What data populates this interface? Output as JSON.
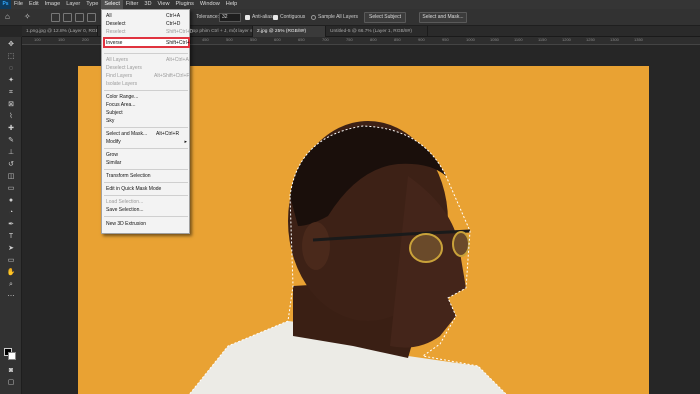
{
  "app": {
    "logo": "Ps"
  },
  "menubar": {
    "items": [
      "File",
      "Edit",
      "Image",
      "Layer",
      "Type",
      "Select",
      "Filter",
      "3D",
      "View",
      "Plugins",
      "Window",
      "Help"
    ]
  },
  "options": {
    "tolerance_label": "Tolerance:",
    "tolerance_value": "32",
    "anti_alias": "Anti-alias",
    "contiguous": "Contiguous",
    "sample_all_layers": "Sample All Layers",
    "select_subject": "Select Subject",
    "select_and_mask": "Select and Mask..."
  },
  "tabs": [
    "1.png.jpg @ 12.8% (Layer 0, RGB/8",
    "hop phim Ctrl + J, một layer sẽ hiện ra chứa đối tượng đã, RGB/8#/CMYK) *",
    "2.jpg @ 25% (RGB/8#)",
    "Untitled-5 @ 66.7% (Layer 1, RGB/8#)"
  ],
  "ruler": [
    "100",
    "150",
    "200",
    "250",
    "300",
    "350",
    "400",
    "450",
    "500",
    "550",
    "600",
    "650",
    "700",
    "750",
    "800",
    "850",
    "900",
    "950",
    "1000",
    "1050",
    "1100",
    "1150",
    "1200",
    "1250",
    "1300",
    "1350"
  ],
  "select_menu": {
    "all": "All",
    "all_sc": "Ctrl+A",
    "deselect": "Deselect",
    "deselect_sc": "Ctrl+D",
    "reselect": "Reselect",
    "reselect_sc": "Shift+Ctrl+D",
    "inverse": "Inverse",
    "inverse_sc": "Shift+Ctrl+I",
    "all_layers": "All Layers",
    "all_layers_sc": "Alt+Ctrl+A",
    "deselect_layers": "Deselect Layers",
    "find_layers": "Find Layers",
    "find_layers_sc": "Alt+Shift+Ctrl+F",
    "isolate_layers": "Isolate Layers",
    "color_range": "Color Range...",
    "focus_area": "Focus Area...",
    "subject": "Subject",
    "sky": "Sky",
    "select_and_mask": "Select and Mask...",
    "select_and_mask_sc": "Alt+Ctrl+R",
    "modify": "Modify",
    "grow": "Grow",
    "similar": "Similar",
    "transform_selection": "Transform Selection",
    "quick_mask": "Edit in Quick Mask Mode",
    "load_selection": "Load Selection...",
    "save_selection": "Save Selection...",
    "new_3d_extrusion": "New 3D Extrusion"
  },
  "colors": {
    "background": "#e9a233",
    "highlight": "#e0333f"
  }
}
